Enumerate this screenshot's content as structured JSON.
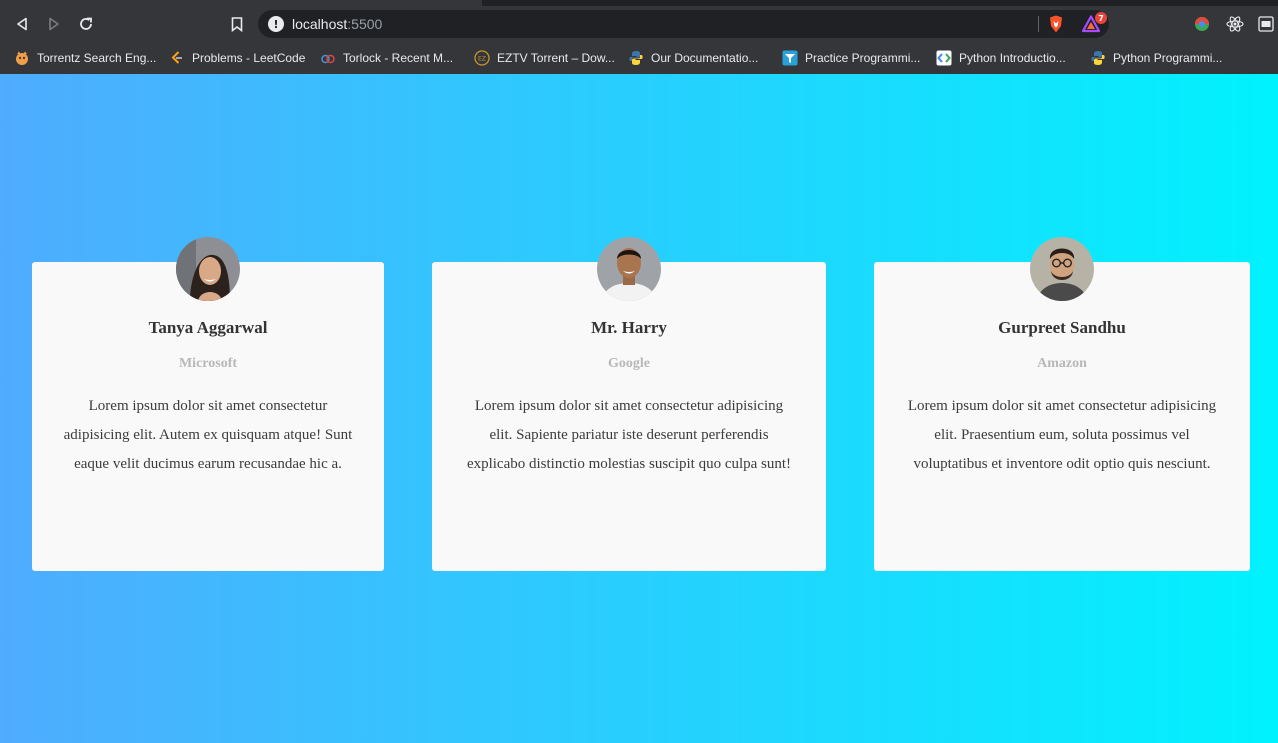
{
  "browser": {
    "url_host": "localhost",
    "url_port": ":5500",
    "rewards_badge": "7",
    "bookmarks": [
      {
        "label": "Torrentz Search Eng...",
        "icon": "torrentz-icon"
      },
      {
        "label": "Problems - LeetCode",
        "icon": "leetcode-icon"
      },
      {
        "label": "Torlock - Recent M...",
        "icon": "torlock-icon"
      },
      {
        "label": "EZTV Torrent – Dow...",
        "icon": "eztv-icon"
      },
      {
        "label": "Our Documentatio...",
        "icon": "python-icon"
      },
      {
        "label": "Practice Programmi...",
        "icon": "practice-icon"
      },
      {
        "label": "Python Introductio...",
        "icon": "google-dev-icon"
      },
      {
        "label": "Python Programmi...",
        "icon": "python-icon"
      }
    ]
  },
  "colors": {
    "gradient_start": "#4facfe",
    "gradient_end": "#00f2fe",
    "card_bg": "#f9f9f9",
    "name": "#333333",
    "company": "#b8b8b8"
  },
  "cards": [
    {
      "name": "Tanya Aggarwal",
      "company": "Microsoft",
      "text": "Lorem ipsum dolor sit amet consectetur adipisicing elit. Autem ex quisquam atque! Sunt eaque velit ducimus earum recusandae hic a."
    },
    {
      "name": "Mr. Harry",
      "company": "Google",
      "text": "Lorem ipsum dolor sit amet consectetur adipisicing elit. Sapiente pariatur iste deserunt perferendis explicabo distinctio molestias suscipit quo culpa sunt!"
    },
    {
      "name": "Gurpreet Sandhu",
      "company": "Amazon",
      "text": "Lorem ipsum dolor sit amet consectetur adipisicing elit. Praesentium eum, soluta possimus vel voluptatibus et inventore odit optio quis nesciunt."
    }
  ]
}
